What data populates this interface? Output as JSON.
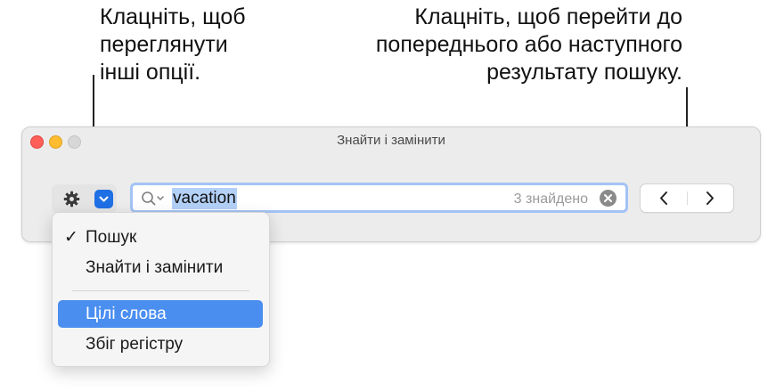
{
  "callouts": {
    "left": [
      "Клацніть, щоб",
      "переглянути",
      "інші опції."
    ],
    "right": [
      "Клацніть, щоб перейти до",
      "попереднього або наступного",
      "результату пошуку."
    ]
  },
  "window": {
    "title": "Знайти і замінити",
    "search": {
      "value": "vacation",
      "result_count": "3 знайдено"
    },
    "icons": {
      "options": "gear-icon",
      "options_menu": "chevron-down-icon",
      "search": "magnifying-glass-icon",
      "clear": "clear-x-icon",
      "previous": "chevron-left-icon",
      "next": "chevron-right-icon"
    }
  },
  "menu": {
    "items": [
      {
        "label": "Пошук",
        "checked": true,
        "check_mark": "✓"
      },
      {
        "label": "Знайти і замінити",
        "checked": false
      },
      {
        "label": "Цілі слова",
        "highlighted": true
      },
      {
        "label": "Збіг регістру",
        "highlighted": false
      }
    ]
  },
  "colors": {
    "accent": "#1f6fe5",
    "highlight": "#4a8ef0",
    "selection": "#b3d0f7",
    "focus_ring": "#a3c3f5"
  }
}
